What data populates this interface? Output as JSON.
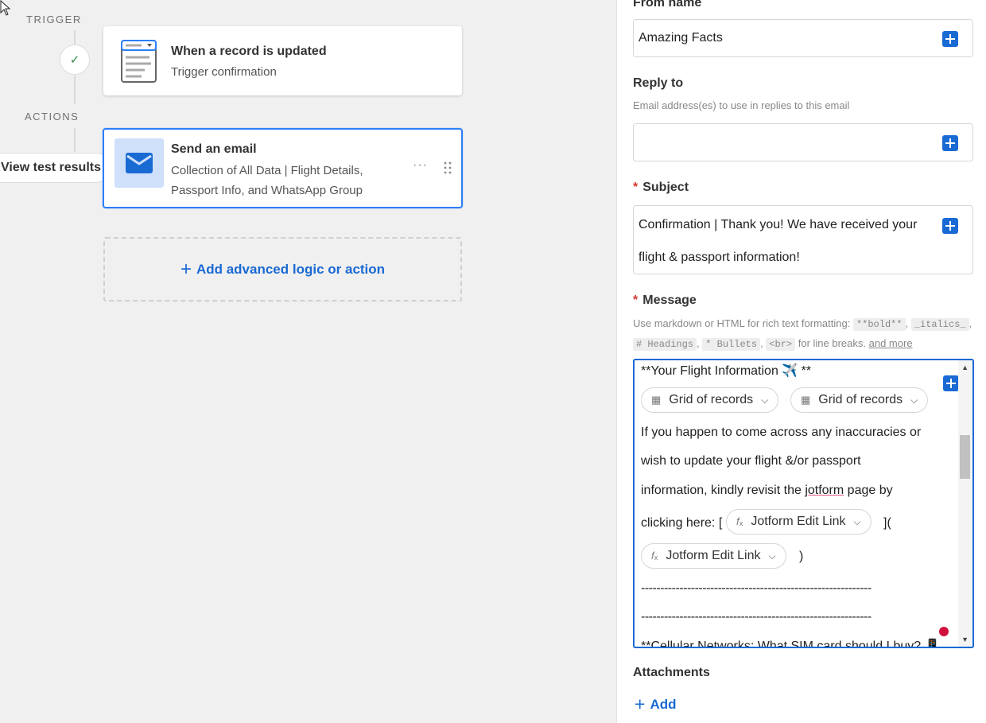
{
  "canvas": {
    "trigger_label": "TRIGGER",
    "actions_label": "ACTIONS",
    "test_results_label": "View test results",
    "trigger_card": {
      "title": "When a record is updated",
      "subtitle": "Trigger confirmation",
      "icon": "record-form-icon"
    },
    "action_card": {
      "title": "Send an email",
      "description_line1": "Collection of All Data | Flight Details,",
      "description_line2": "Passport Info, and WhatsApp Group",
      "icon": "envelope-icon"
    },
    "add_action_label": "Add advanced logic or action"
  },
  "panel": {
    "from_name": {
      "label": "From name",
      "value": "Amazing Facts"
    },
    "reply_to": {
      "label": "Reply to",
      "helper": "Email address(es) to use in replies to this email",
      "value": ""
    },
    "subject": {
      "label": "Subject",
      "line1": "Confirmation | Thank you! We have received your",
      "line2": "flight & passport information!"
    },
    "message": {
      "label": "Message",
      "helper_prefix": "Use markdown or HTML for rich text formatting:",
      "code_bold": "**bold**",
      "code_italics": "_italics_",
      "code_headings": "# Headings",
      "code_bullets": "* Bullets",
      "code_br": "<br>",
      "helper_linebreaks": "for line breaks.",
      "helper_link": "and more",
      "body": {
        "line_heading": "**Your Flight Information ✈️ **",
        "token_grid_1": "Grid of records",
        "token_grid_2": "Grid of records",
        "para1": "If you happen to come across any inaccuracies or",
        "para2": "wish to update your flight &/or passport",
        "para3_before": "information, kindly revisit the ",
        "para3_misspelled": "jotform",
        "para3_after": " page by",
        "para4_prefix": "clicking here: [",
        "token_jotform_1": "Jotform Edit Link",
        "para4_suffix": "](",
        "token_jotform_2": "Jotform Edit Link",
        "para5_suffix": ")",
        "divider1": "------------------------------------------------------------",
        "divider2": "------------------------------------------------------------",
        "line_cellular": "**Cellular Networks: What SIM card should I buy? 📱"
      }
    },
    "attachments": {
      "label": "Attachments",
      "add_label": "Add"
    }
  },
  "colors": {
    "accent": "#1a6ad4",
    "selected_border": "#2d7ff9",
    "required": "#d43a2f",
    "success": "#2e8a4a"
  }
}
